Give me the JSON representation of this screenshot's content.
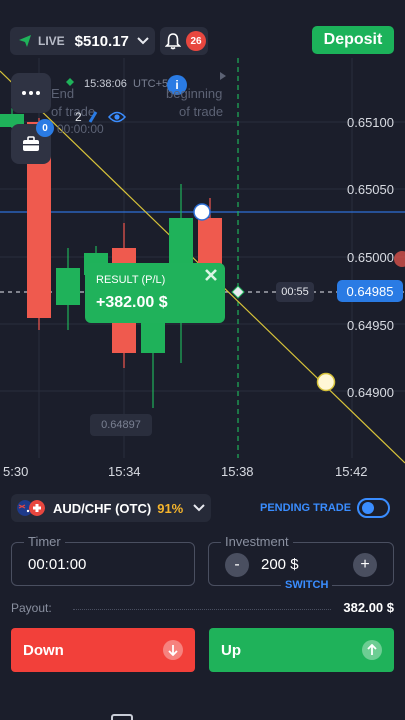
{
  "header": {
    "mode_label": "LIVE",
    "balance": "$510.17",
    "notifications_count": "26",
    "deposit_label": "Deposit"
  },
  "chart_overlay": {
    "menu_icon": "more-dots-icon",
    "portfolio_icon": "briefcase-icon",
    "open_trades_badge": "0",
    "server_time": "15:38:06",
    "timezone": "UTC+5",
    "end_label_1": "End",
    "end_label_2": "of trade",
    "begin_label_1": "beginning",
    "begin_label_2": "of trade",
    "trade_count": "2",
    "trade_timer": "00:00:00",
    "countdown": "00:55",
    "current_price": "0.64985",
    "low_price": "0.64897",
    "info_icon": "i"
  },
  "price_axis": [
    "0.65100",
    "0.65050",
    "0.65000",
    "0.64950",
    "0.64900"
  ],
  "time_axis": [
    "5:30",
    "15:34",
    "15:38",
    "15:42"
  ],
  "result": {
    "title": "RESULT (P/L)",
    "value": "+382.00 $"
  },
  "asset": {
    "name": "AUD/CHF (OTC)",
    "payout_pct": "91%",
    "pending_label": "PENDING TRADE"
  },
  "timer": {
    "label": "Timer",
    "value": "00:01:00"
  },
  "investment": {
    "label": "Investment",
    "value": "200 $",
    "switch_label": "SWITCH",
    "minus": "-",
    "plus": "+"
  },
  "payout": {
    "label": "Payout:",
    "value": "382.00 $"
  },
  "actions": {
    "down_label": "Down",
    "up_label": "Up"
  },
  "colors": {
    "background": "#1b1e2b",
    "up_green": "#1fb25a",
    "down_red": "#f2403a",
    "accent_blue": "#2a7be4",
    "payout_yellow": "#f5b42c"
  }
}
